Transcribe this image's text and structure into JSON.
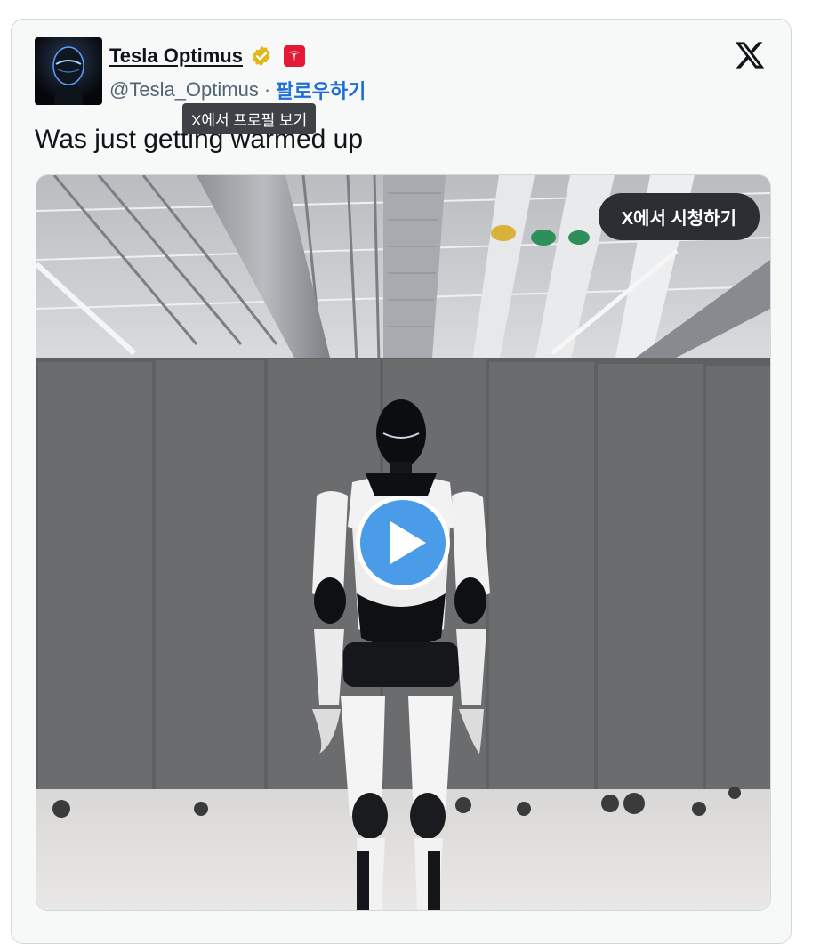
{
  "author": {
    "name": "Tesla Optimus",
    "handle": "@Tesla_Optimus",
    "separator": "·",
    "follow_label": "팔로우하기",
    "profile_tooltip": "X에서 프로필 보기"
  },
  "tweet": {
    "text": "Was just getting warmed up"
  },
  "media": {
    "watch_label": "X에서 시청하기"
  },
  "colors": {
    "follow": "#1d6fd6",
    "tesla_red": "#e31937",
    "verified_gold": "#e2b719",
    "play_blue": "#4a9be8"
  },
  "icons": [
    "verified-badge-icon",
    "tesla-logo-icon",
    "x-logo-icon",
    "play-icon"
  ]
}
